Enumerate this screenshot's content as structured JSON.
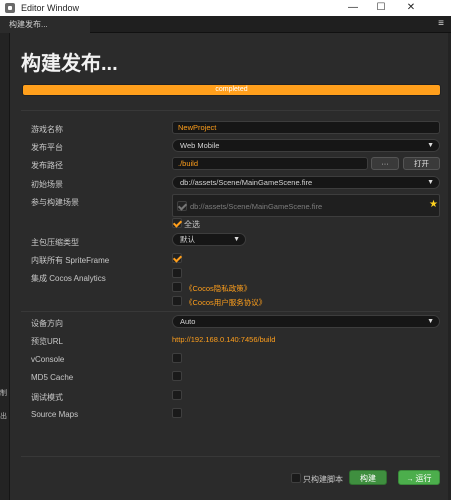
{
  "window": {
    "title": "Editor Window",
    "tab": "构建发布..."
  },
  "heading": "构建发布...",
  "progress": {
    "label": "completed",
    "value": 1.0
  },
  "fields": {
    "game_name": {
      "label": "游戏名称",
      "value": "NewProject"
    },
    "platform": {
      "label": "发布平台",
      "value": "Web Mobile"
    },
    "path": {
      "label": "发布路径",
      "value": "./build",
      "browse": "···",
      "open": "打开"
    },
    "start_scene": {
      "label": "初始场景",
      "value": "db://assets/Scene/MainGameScene.fire"
    },
    "scenes": {
      "label": "参与构建场景",
      "value": "db://assets/Scene/MainGameScene.fire",
      "select_all": "全选"
    },
    "compression": {
      "label": "主包压缩类型",
      "value": "默认"
    },
    "inline_sprites": {
      "label": "内联所有 SpriteFrame"
    },
    "analytics": {
      "label": "集成 Cocos Analytics",
      "privacy": "《Cocos隐私政策》",
      "terms": "《Cocos用户服务协议》"
    },
    "orientation": {
      "label": "设备方向",
      "value": "Auto"
    },
    "preview_url": {
      "label": "预览URL",
      "value": "http://192.168.0.140:7456/build"
    },
    "vconsole": {
      "label": "vConsole"
    },
    "md5": {
      "label": "MD5 Cache"
    },
    "debug": {
      "label": "调试模式"
    },
    "source_maps": {
      "label": "Source Maps"
    }
  },
  "footer": {
    "build_script_only": "只构建脚本",
    "build": "构建",
    "run": "运行"
  },
  "colors": {
    "accent": "#ff9f1c",
    "build_button": "#3f8f3f",
    "run_button": "#4cae4c"
  },
  "icons": {
    "app": "app-icon",
    "minimize": "minimize-icon",
    "maximize": "maximize-icon",
    "close": "close-icon",
    "star": "star-icon"
  }
}
